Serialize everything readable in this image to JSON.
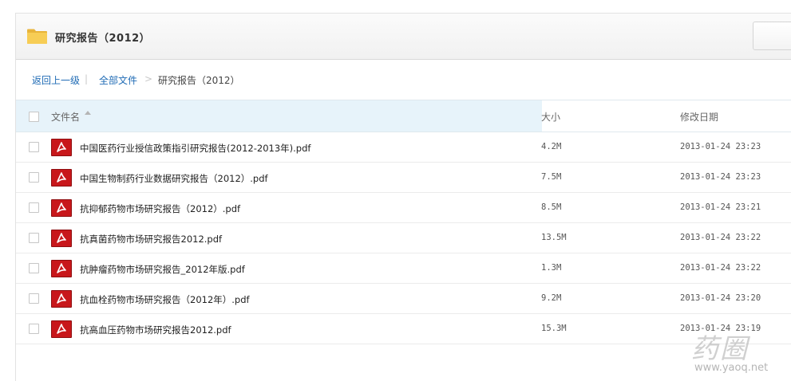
{
  "folder": {
    "title": "研究报告（2012）",
    "icon": "folder-icon"
  },
  "breadcrumb": {
    "back_label": "返回上一级",
    "divider": "|",
    "all_files_label": "全部文件",
    "arrow": ">",
    "current_label": "研究报告（2012）"
  },
  "columns": {
    "name": "文件名",
    "size": "大小",
    "modified": "修改日期"
  },
  "files": [
    {
      "name": "中国医药行业授信政策指引研究报告(2012-2013年).pdf",
      "size": "4.2M",
      "modified": "2013-01-24 23:23",
      "icon": "pdf-icon"
    },
    {
      "name": "中国生物制药行业数据研究报告（2012）.pdf",
      "size": "7.5M",
      "modified": "2013-01-24 23:23",
      "icon": "pdf-icon"
    },
    {
      "name": "抗抑郁药物市场研究报告（2012）.pdf",
      "size": "8.5M",
      "modified": "2013-01-24 23:21",
      "icon": "pdf-icon"
    },
    {
      "name": "抗真菌药物市场研究报告2012.pdf",
      "size": "13.5M",
      "modified": "2013-01-24 23:22",
      "icon": "pdf-icon"
    },
    {
      "name": "抗肿瘤药物市场研究报告_2012年版.pdf",
      "size": "1.3M",
      "modified": "2013-01-24 23:22",
      "icon": "pdf-icon"
    },
    {
      "name": "抗血栓药物市场研究报告（2012年）.pdf",
      "size": "9.2M",
      "modified": "2013-01-24 23:20",
      "icon": "pdf-icon"
    },
    {
      "name": "抗高血压药物市场研究报告2012.pdf",
      "size": "15.3M",
      "modified": "2013-01-24 23:19",
      "icon": "pdf-icon"
    }
  ],
  "watermark": {
    "glyphs": "药圈",
    "url": "www.yaoq.net"
  },
  "colors": {
    "link": "#1f6bb5",
    "header_highlight": "#e7f3fa",
    "pdf_red": "#c8171b",
    "folder_yellow": "#f5c542"
  }
}
